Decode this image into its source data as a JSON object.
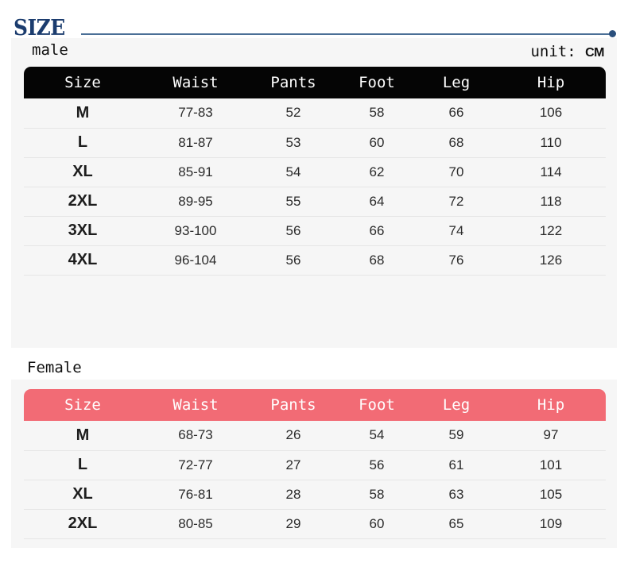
{
  "brand": {
    "logo_text": "SIZE",
    "rule_dot_color": "#2a4f7c",
    "logo_color": "#1b3c6e"
  },
  "unit": {
    "label": "unit:",
    "value": "CM"
  },
  "sections": {
    "male": {
      "label": "male",
      "header_color": "#050505",
      "columns": [
        "Size",
        "Waist",
        "Pants",
        "Foot",
        "Leg",
        "Hip"
      ],
      "rows": [
        {
          "size": "M",
          "waist": "77-83",
          "pants": "52",
          "foot": "58",
          "leg": "66",
          "hip": "106"
        },
        {
          "size": "L",
          "waist": "81-87",
          "pants": "53",
          "foot": "60",
          "leg": "68",
          "hip": "110"
        },
        {
          "size": "XL",
          "waist": "85-91",
          "pants": "54",
          "foot": "62",
          "leg": "70",
          "hip": "114"
        },
        {
          "size": "2XL",
          "waist": "89-95",
          "pants": "55",
          "foot": "64",
          "leg": "72",
          "hip": "118"
        },
        {
          "size": "3XL",
          "waist": "93-100",
          "pants": "56",
          "foot": "66",
          "leg": "74",
          "hip": "122"
        },
        {
          "size": "4XL",
          "waist": "96-104",
          "pants": "56",
          "foot": "68",
          "leg": "76",
          "hip": "126"
        }
      ]
    },
    "female": {
      "label": "Female",
      "header_color": "#f26b75",
      "columns": [
        "Size",
        "Waist",
        "Pants",
        "Foot",
        "Leg",
        "Hip"
      ],
      "rows": [
        {
          "size": "M",
          "waist": "68-73",
          "pants": "26",
          "foot": "54",
          "leg": "59",
          "hip": "97"
        },
        {
          "size": "L",
          "waist": "72-77",
          "pants": "27",
          "foot": "56",
          "leg": "61",
          "hip": "101"
        },
        {
          "size": "XL",
          "waist": "76-81",
          "pants": "28",
          "foot": "58",
          "leg": "63",
          "hip": "105"
        },
        {
          "size": "2XL",
          "waist": "80-85",
          "pants": "29",
          "foot": "60",
          "leg": "65",
          "hip": "109"
        }
      ]
    }
  }
}
